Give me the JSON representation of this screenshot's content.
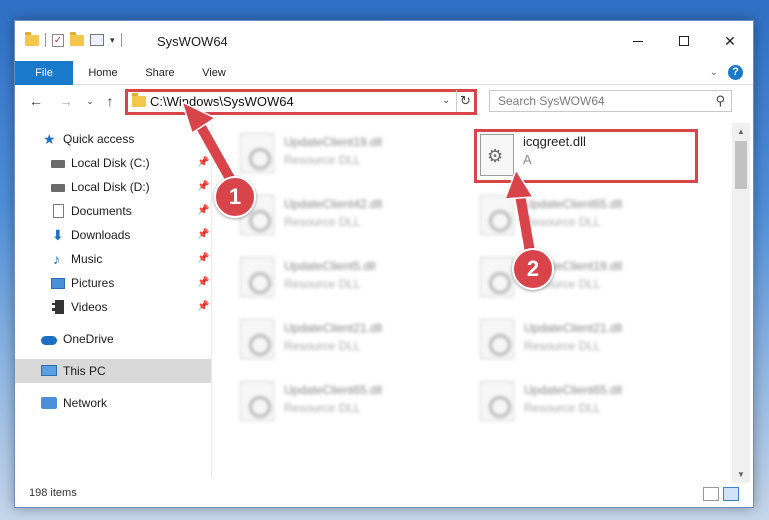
{
  "window": {
    "title": "SysWOW64",
    "qat_check": "✓",
    "qat_down": "▾",
    "minimize": "",
    "maximize": "",
    "close": "✕"
  },
  "ribbon": {
    "tabs": [
      {
        "label": "File"
      },
      {
        "label": "Home"
      },
      {
        "label": "Share"
      },
      {
        "label": "View"
      }
    ],
    "expand_glyph": "⌄",
    "help_glyph": "?"
  },
  "nav": {
    "back": "←",
    "forward": "→",
    "recent": "⌄",
    "up": "↑"
  },
  "address": {
    "path": "C:\\Windows\\SysWOW64",
    "dropdown": "⌄",
    "refresh": "↻"
  },
  "search": {
    "placeholder": "Search SysWOW64",
    "icon": "⚲"
  },
  "sidebar": {
    "items": [
      {
        "label": "Quick access",
        "pin": ""
      },
      {
        "label": "Local Disk (C:)",
        "pin": "📌"
      },
      {
        "label": "Local Disk (D:)",
        "pin": "📌"
      },
      {
        "label": "Documents",
        "pin": "📌"
      },
      {
        "label": "Downloads",
        "pin": "📌"
      },
      {
        "label": "Music",
        "pin": "📌"
      },
      {
        "label": "Pictures",
        "pin": "📌"
      },
      {
        "label": "Videos",
        "pin": "📌"
      },
      {
        "label": "OneDrive",
        "pin": ""
      },
      {
        "label": "This PC",
        "pin": ""
      },
      {
        "label": "Network",
        "pin": ""
      }
    ],
    "icons": {
      "star": "★",
      "download": "⬇",
      "music": "♪"
    }
  },
  "files": {
    "left": [
      {
        "name": "UpdateClient19.dll",
        "type": "Resource DLL"
      },
      {
        "name": "UpdateClient42.dll",
        "type": "Resource DLL"
      },
      {
        "name": "UpdateClient5.dll",
        "type": "Resource DLL"
      },
      {
        "name": "UpdateClient21.dll",
        "type": "Resource DLL"
      },
      {
        "name": "UpdateClient65.dll",
        "type": "Resource DLL"
      }
    ],
    "right": [
      {
        "name": "UpdateClient65.dll",
        "type": "Resource DLL"
      },
      {
        "name": "UpdateClient19.dll",
        "type": "Resource DLL"
      },
      {
        "name": "UpdateClient21.dll",
        "type": "Resource DLL"
      },
      {
        "name": "UpdateClient65.dll",
        "type": "Resource DLL"
      }
    ],
    "target": {
      "name": "icqgreet.dll",
      "type": "A",
      "gear": "⚙"
    }
  },
  "scrollbar": {
    "up": "▲",
    "down": "▼"
  },
  "status": {
    "item_count": "198 items"
  },
  "annotations": {
    "step1": "1",
    "step2": "2",
    "color": "#d9444b"
  }
}
